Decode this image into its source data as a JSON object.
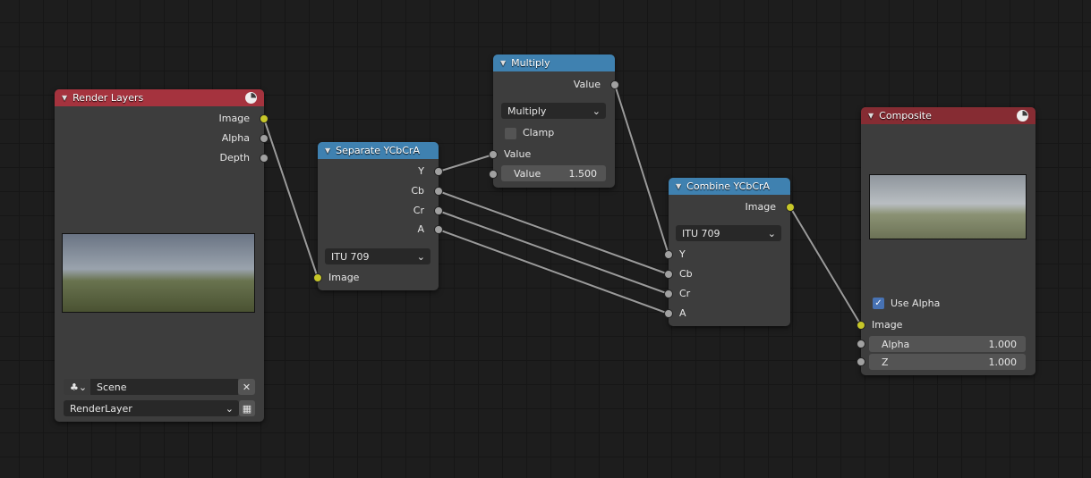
{
  "nodes": {
    "render_layers": {
      "title": "Render Layers",
      "outputs": [
        "Image",
        "Alpha",
        "Depth"
      ],
      "scene": "Scene",
      "layer": "RenderLayer"
    },
    "separate": {
      "title": "Separate YCbCrA",
      "outputs": [
        "Y",
        "Cb",
        "Cr",
        "A"
      ],
      "mode": "ITU 709",
      "input": "Image"
    },
    "multiply": {
      "title": "Multiply",
      "output": "Value",
      "operation": "Multiply",
      "clamp_label": "Clamp",
      "clamp": false,
      "input1": "Value",
      "input2_label": "Value",
      "input2_value": "1.500"
    },
    "combine": {
      "title": "Combine YCbCrA",
      "output": "Image",
      "mode": "ITU 709",
      "inputs": [
        "Y",
        "Cb",
        "Cr",
        "A"
      ]
    },
    "composite": {
      "title": "Composite",
      "use_alpha_label": "Use Alpha",
      "use_alpha": true,
      "input": "Image",
      "alpha_label": "Alpha",
      "alpha_value": "1.000",
      "z_label": "Z",
      "z_value": "1.000"
    }
  },
  "colors": {
    "input_header": "#a5333e",
    "output_header": "#862c33",
    "converter_header": "#3f81b0",
    "image_socket": "#c7c729",
    "value_socket": "#a1a1a1",
    "link": "#9a9a9a"
  }
}
